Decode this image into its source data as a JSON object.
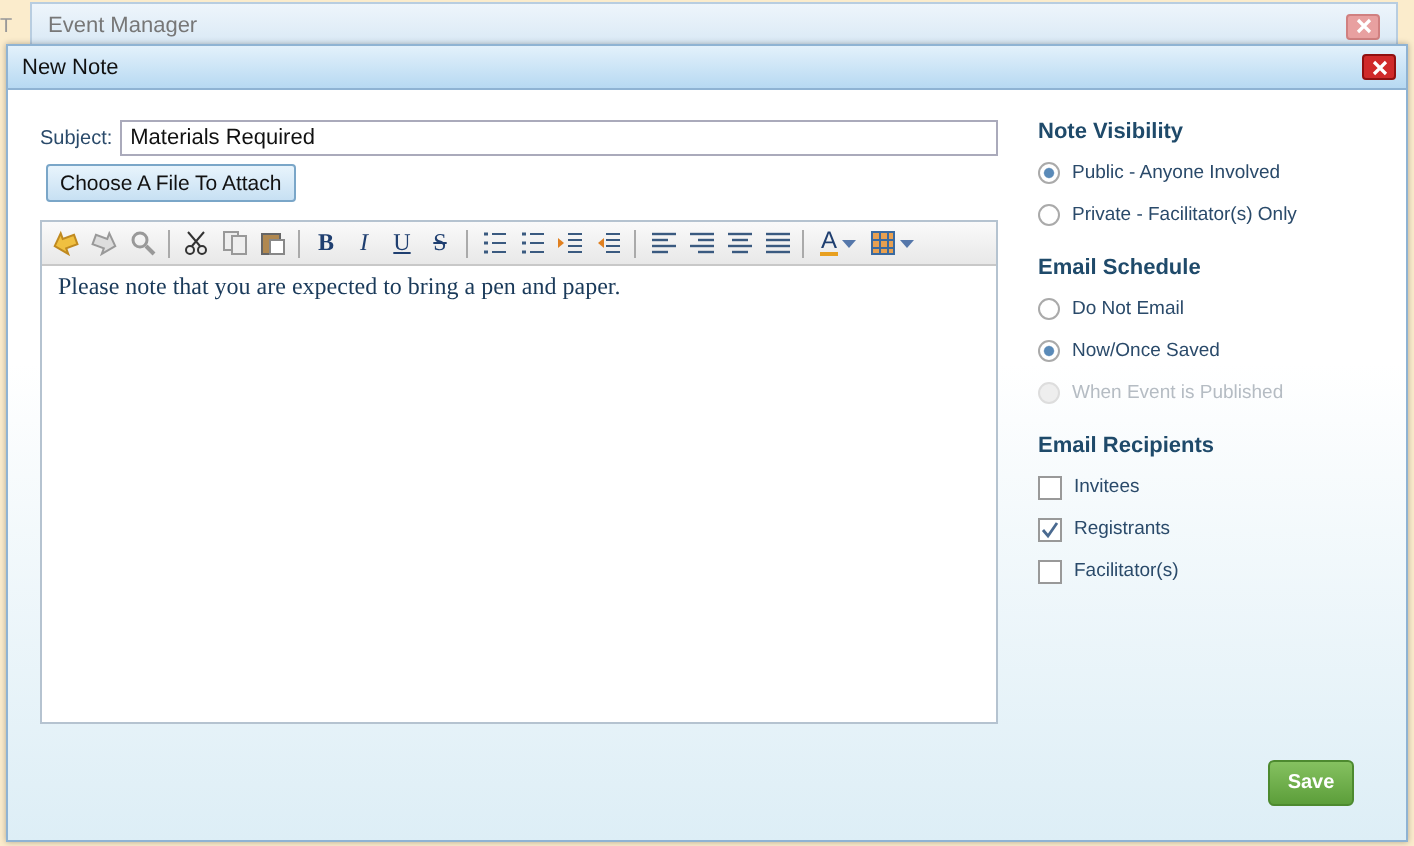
{
  "background_text": [
    "T"
  ],
  "outer_window": {
    "title": "Event Manager"
  },
  "dialog": {
    "title": "New Note"
  },
  "subject": {
    "label": "Subject:",
    "value": "Materials Required"
  },
  "attach_button": "Choose A File To Attach",
  "toolbar": [
    [
      {
        "kind": "undo"
      },
      {
        "kind": "redo"
      },
      {
        "kind": "find"
      }
    ],
    [
      {
        "kind": "cut"
      },
      {
        "kind": "copy"
      },
      {
        "kind": "paste"
      }
    ],
    [
      {
        "kind": "bold",
        "label": "B"
      },
      {
        "kind": "italic",
        "label": "I"
      },
      {
        "kind": "underline",
        "label": "U"
      },
      {
        "kind": "strike",
        "label": "S"
      }
    ],
    [
      {
        "kind": "ordered"
      },
      {
        "kind": "bullets"
      },
      {
        "kind": "indent"
      },
      {
        "kind": "outdent"
      }
    ],
    [
      {
        "kind": "left"
      },
      {
        "kind": "right"
      },
      {
        "kind": "center"
      },
      {
        "kind": "justify"
      }
    ],
    [
      {
        "kind": "fontcolor",
        "label": "A"
      },
      {
        "kind": "table"
      }
    ]
  ],
  "editor_text": "Please note that you are expected to bring a pen and paper.",
  "sections": [
    {
      "title": "Note Visibility",
      "kind": "radio",
      "options": [
        {
          "label": "Public - Anyone Involved",
          "selected": true,
          "disabled": false
        },
        {
          "label": "Private - Facilitator(s) Only",
          "selected": false,
          "disabled": false
        }
      ]
    },
    {
      "title": "Email Schedule",
      "kind": "radio",
      "options": [
        {
          "label": "Do Not Email",
          "selected": false,
          "disabled": false
        },
        {
          "label": "Now/Once Saved",
          "selected": true,
          "disabled": false
        },
        {
          "label": "When Event is Published",
          "selected": false,
          "disabled": true
        }
      ]
    },
    {
      "title": "Email Recipients",
      "kind": "checkbox",
      "options": [
        {
          "label": "Invitees",
          "checked": false
        },
        {
          "label": "Registrants",
          "checked": true
        },
        {
          "label": "Facilitator(s)",
          "checked": false
        }
      ]
    }
  ],
  "save_button": "Save"
}
